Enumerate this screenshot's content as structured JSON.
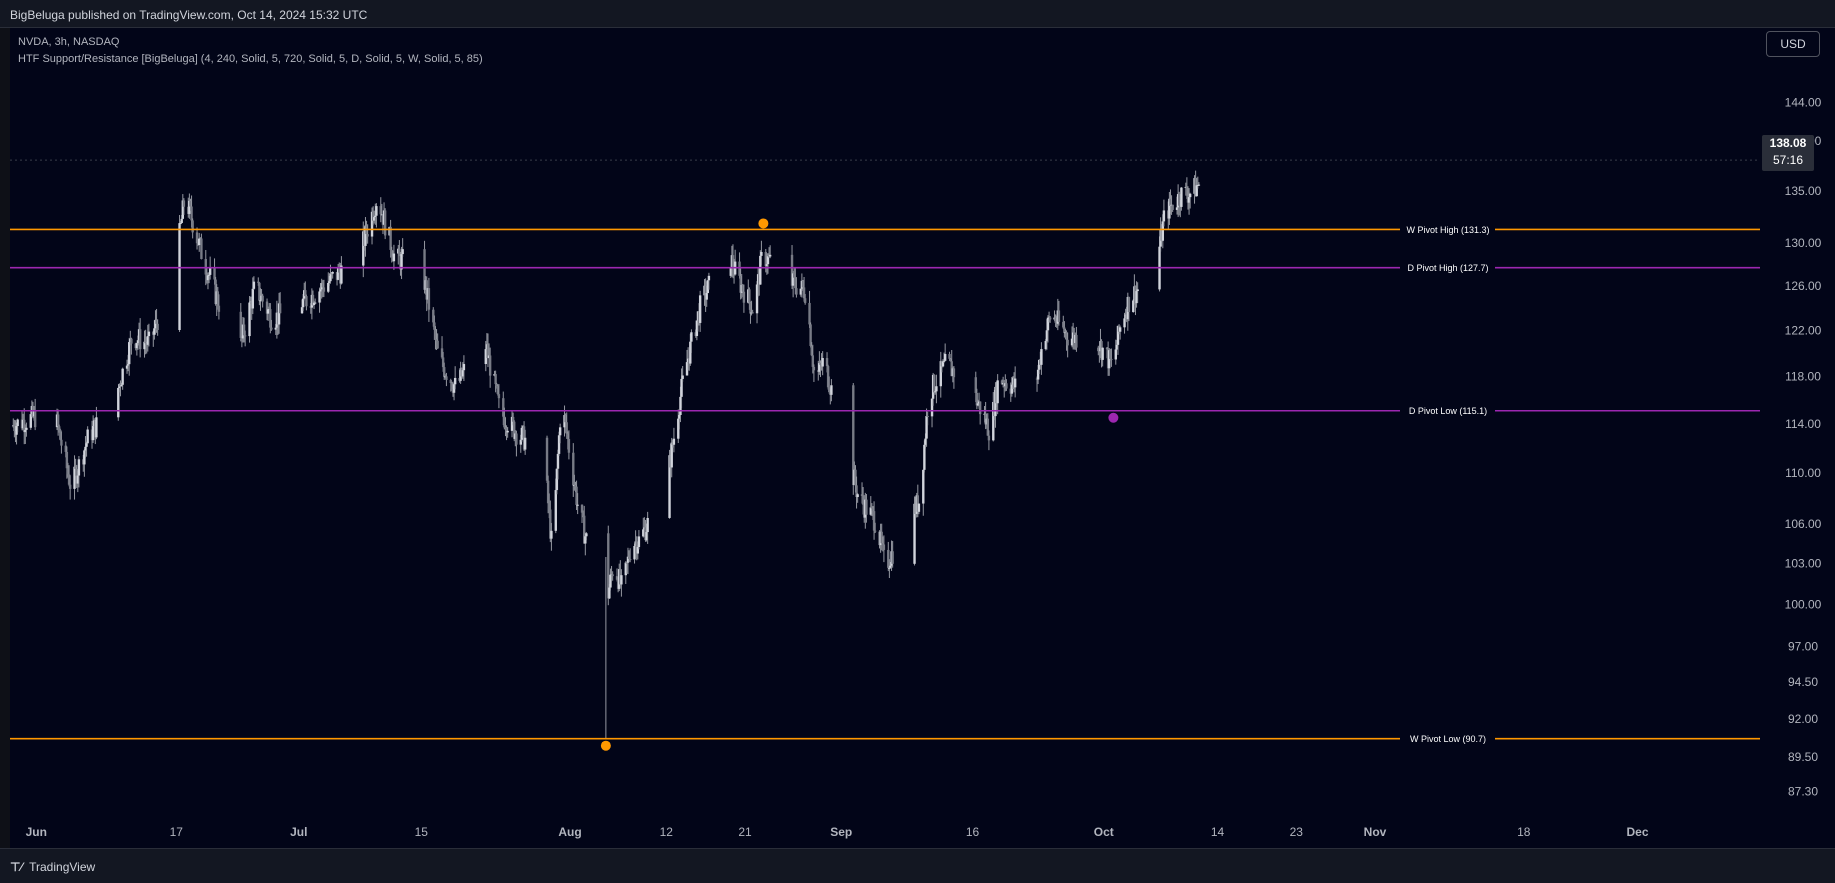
{
  "header": {
    "publisher": "BigBeluga published on TradingView.com, Oct 14, 2024 15:32 UTC"
  },
  "legend": {
    "symbol": "NVDA, 3h, NASDAQ",
    "indicator": "HTF Support/Resistance [BigBeluga] (4, 240, Solid, 5, 720, Solid, 5, D, Solid, 5, W, Solid, 5, 85)"
  },
  "currency_button": "USD",
  "last_price": {
    "price": "138.08",
    "countdown": "57:16"
  },
  "footer": {
    "brand": "TradingView"
  },
  "colors": {
    "background": "#020518",
    "candle": "#b2b5be",
    "weekly_level": "#ff9800",
    "daily_level": "#9c27b0"
  },
  "chart_data": {
    "type": "candlestick",
    "y_scale": "log",
    "ylim": [
      85.5,
      148.5
    ],
    "y_ticks": [
      144.0,
      140.0,
      135.0,
      130.0,
      126.0,
      122.0,
      118.0,
      114.0,
      110.0,
      106.0,
      103.0,
      100.0,
      97.0,
      94.5,
      92.0,
      89.5,
      87.3
    ],
    "y_tick_labels": [
      "144.00",
      "140.00",
      "135.00",
      "130.00",
      "126.00",
      "122.00",
      "118.00",
      "114.00",
      "110.00",
      "106.00",
      "103.00",
      "100.00",
      "97.00",
      "94.50",
      "92.00",
      "89.50",
      "87.30"
    ],
    "x_range": [
      "2024-05-29",
      "2024-12-15"
    ],
    "x_ticks": [
      {
        "date": "2024-06-01",
        "label": "Jun"
      },
      {
        "date": "2024-06-17",
        "label": "17"
      },
      {
        "date": "2024-07-01",
        "label": "Jul"
      },
      {
        "date": "2024-07-15",
        "label": "15"
      },
      {
        "date": "2024-08-01",
        "label": "Aug"
      },
      {
        "date": "2024-08-12",
        "label": "12"
      },
      {
        "date": "2024-08-21",
        "label": "21"
      },
      {
        "date": "2024-09-01",
        "label": "Sep"
      },
      {
        "date": "2024-09-16",
        "label": "16"
      },
      {
        "date": "2024-10-01",
        "label": "Oct"
      },
      {
        "date": "2024-10-14",
        "label": "14"
      },
      {
        "date": "2024-10-23",
        "label": "23"
      },
      {
        "date": "2024-11-01",
        "label": "Nov"
      },
      {
        "date": "2024-11-18",
        "label": "18"
      },
      {
        "date": "2024-12-01",
        "label": "Dec"
      }
    ],
    "close_path": [
      [
        "2024-05-29",
        113.8
      ],
      [
        "2024-06-03",
        115.2
      ],
      [
        "2024-06-05",
        108.8
      ],
      [
        "2024-06-07",
        113.0
      ],
      [
        "2024-06-10",
        116.0
      ],
      [
        "2024-06-12",
        121.5
      ],
      [
        "2024-06-14",
        120.8
      ],
      [
        "2024-06-17",
        128.5
      ],
      [
        "2024-06-18",
        134.5
      ],
      [
        "2024-06-20",
        128.8
      ],
      [
        "2024-06-24",
        119.5
      ],
      [
        "2024-06-26",
        126.0
      ],
      [
        "2024-06-28",
        123.0
      ],
      [
        "2024-07-02",
        124.8
      ],
      [
        "2024-07-05",
        126.8
      ],
      [
        "2024-07-08",
        129.0
      ],
      [
        "2024-07-10",
        134.5
      ],
      [
        "2024-07-12",
        128.5
      ],
      [
        "2024-07-15",
        128.0
      ],
      [
        "2024-07-17",
        119.5
      ],
      [
        "2024-07-19",
        117.0
      ],
      [
        "2024-07-22",
        122.0
      ],
      [
        "2024-07-24",
        115.0
      ],
      [
        "2024-07-26",
        113.2
      ],
      [
        "2024-07-29",
        111.5
      ],
      [
        "2024-07-30",
        103.7
      ],
      [
        "2024-07-31",
        116.0
      ],
      [
        "2024-08-02",
        107.0
      ],
      [
        "2024-08-05",
        99.5
      ],
      [
        "2024-08-06",
        103.0
      ],
      [
        "2024-08-07",
        101.0
      ],
      [
        "2024-08-08",
        104.5
      ],
      [
        "2024-08-09",
        104.8
      ],
      [
        "2024-08-12",
        109.0
      ],
      [
        "2024-08-14",
        118.0
      ],
      [
        "2024-08-16",
        124.5
      ],
      [
        "2024-08-19",
        129.5
      ],
      [
        "2024-08-20",
        127.0
      ],
      [
        "2024-08-22",
        123.8
      ],
      [
        "2024-08-23",
        129.0
      ],
      [
        "2024-08-26",
        126.5
      ],
      [
        "2024-08-28",
        125.5
      ],
      [
        "2024-08-29",
        117.5
      ],
      [
        "2024-08-30",
        119.4
      ],
      [
        "2024-09-03",
        108.0
      ],
      [
        "2024-09-05",
        106.2
      ],
      [
        "2024-09-06",
        102.8
      ],
      [
        "2024-09-09",
        106.5
      ],
      [
        "2024-09-10",
        108.0
      ],
      [
        "2024-09-11",
        116.5
      ],
      [
        "2024-09-13",
        119.1
      ],
      [
        "2024-09-16",
        116.8
      ],
      [
        "2024-09-18",
        113.4
      ],
      [
        "2024-09-19",
        117.9
      ],
      [
        "2024-09-23",
        116.3
      ],
      [
        "2024-09-24",
        120.9
      ],
      [
        "2024-09-25",
        123.5
      ],
      [
        "2024-09-27",
        121.4
      ],
      [
        "2024-09-30",
        121.4
      ],
      [
        "2024-10-02",
        118.9
      ],
      [
        "2024-10-03",
        122.8
      ],
      [
        "2024-10-04",
        124.9
      ],
      [
        "2024-10-07",
        127.7
      ],
      [
        "2024-10-08",
        132.9
      ],
      [
        "2024-10-10",
        134.8
      ],
      [
        "2024-10-11",
        134.8
      ],
      [
        "2024-10-14",
        138.08
      ]
    ],
    "levels": [
      {
        "label": "W Pivot High (131.3)",
        "price": 131.3,
        "color": "#ff9800"
      },
      {
        "label": "D Pivot High (127.7)",
        "price": 127.7,
        "color": "#9c27b0"
      },
      {
        "label": "D Pivot Low (115.1)",
        "price": 115.1,
        "color": "#9c27b0"
      },
      {
        "label": "W Pivot Low (90.7)",
        "price": 90.7,
        "color": "#ff9800"
      }
    ],
    "pivot_markers": [
      {
        "date": "2024-08-23",
        "price": 131.3,
        "color": "#ff9800",
        "position": "above"
      },
      {
        "date": "2024-10-02",
        "price": 115.1,
        "color": "#9c27b0",
        "position": "below"
      },
      {
        "date": "2024-08-05",
        "price": 90.7,
        "color": "#ff9800",
        "position": "below"
      }
    ]
  }
}
